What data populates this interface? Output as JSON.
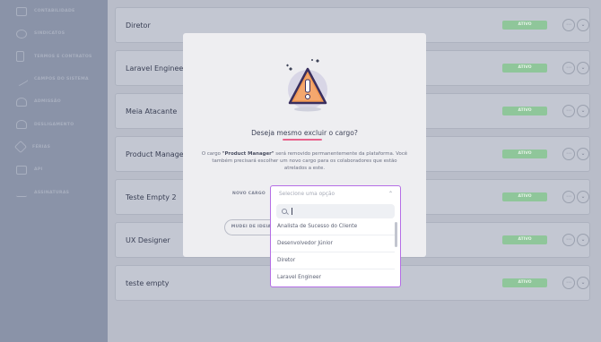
{
  "sidebar": {
    "items": [
      {
        "label": "CONTABILIDADE",
        "icon": "accounting-icon"
      },
      {
        "label": "SINDICATOS",
        "icon": "union-icon"
      },
      {
        "label": "TERMOS E CONTRATOS",
        "icon": "document-icon"
      },
      {
        "label": "CAMPOS DO SISTEMA",
        "icon": "fields-icon"
      },
      {
        "label": "ADMISSÃO",
        "icon": "admission-icon"
      },
      {
        "label": "DESLIGAMENTO",
        "icon": "dismissal-icon"
      },
      {
        "label": "FÉRIAS",
        "icon": "vacation-icon"
      },
      {
        "label": "API",
        "icon": "api-icon"
      },
      {
        "label": "ASSINATURAS",
        "icon": "signature-icon"
      }
    ]
  },
  "roles": [
    {
      "name": "Diretor",
      "status": "ATIVO"
    },
    {
      "name": "Laravel Engineer",
      "status": "ATIVO"
    },
    {
      "name": "Meia Atacante",
      "status": "ATIVO"
    },
    {
      "name": "Product Manager",
      "status": "ATIVO"
    },
    {
      "name": "Teste Empty 2",
      "status": "ATIVO"
    },
    {
      "name": "UX Designer",
      "status": "ATIVO"
    },
    {
      "name": "teste empty",
      "status": "ATIVO"
    }
  ],
  "modal": {
    "title": "Deseja mesmo excluir o cargo?",
    "desc_prefix": "O cargo ",
    "desc_role": "\"Product Manager\"",
    "desc_suffix": " será removido permanentemente da plataforma. Você também precisará escolher um novo cargo para os colaboradores que estão atrelados a este.",
    "field_label": "NOVO CARGO",
    "cancel_label": "MUDEI DE IDEIA",
    "select": {
      "placeholder": "Selecione uma opção",
      "search_value": "",
      "options": [
        "Analista de Sucesso do Cliente",
        "Desenvolvedor Júnior",
        "Diretor",
        "Laravel Engineer"
      ]
    }
  },
  "colors": {
    "accent": "#b56ee6",
    "warning_pink": "#e8648e",
    "active_badge": "#8fc69a"
  }
}
